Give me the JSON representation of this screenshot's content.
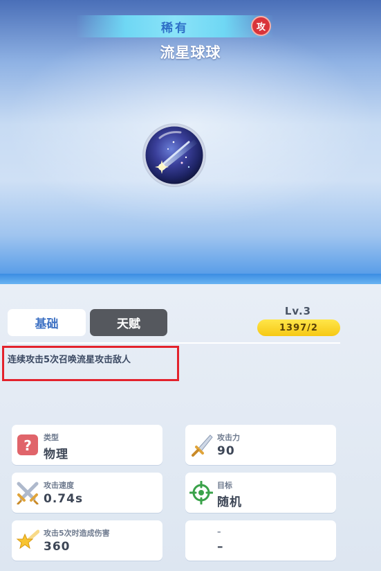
{
  "header": {
    "rarity": "稀有",
    "attack_badge": "攻",
    "item_name": "流星球球"
  },
  "tabs": [
    {
      "label": "基础",
      "active": true
    },
    {
      "label": "天赋",
      "active": false
    }
  ],
  "level": {
    "label": "Lv.3",
    "progress": "1397/2"
  },
  "description": "连续攻击5次召唤流星攻击敌人",
  "stats": [
    {
      "label": "类型",
      "value": "物理",
      "icon": "question-mark-icon"
    },
    {
      "label": "攻击力",
      "value": "90",
      "icon": "sword-icon"
    },
    {
      "label": "攻击速度",
      "value": "0.74s",
      "icon": "crossed-swords-icon"
    },
    {
      "label": "目标",
      "value": "随机",
      "icon": "crosshair-target-icon"
    },
    {
      "label": "攻击5次时造成伤害",
      "value": "360",
      "icon": "shooting-star-icon"
    },
    {
      "label": "–",
      "value": "–",
      "icon": ""
    }
  ],
  "colors": {
    "accent_blue": "#3f72c4",
    "highlight_red": "#e3222c",
    "level_yellow": "#f6c814",
    "badge_red": "#d9343a"
  }
}
